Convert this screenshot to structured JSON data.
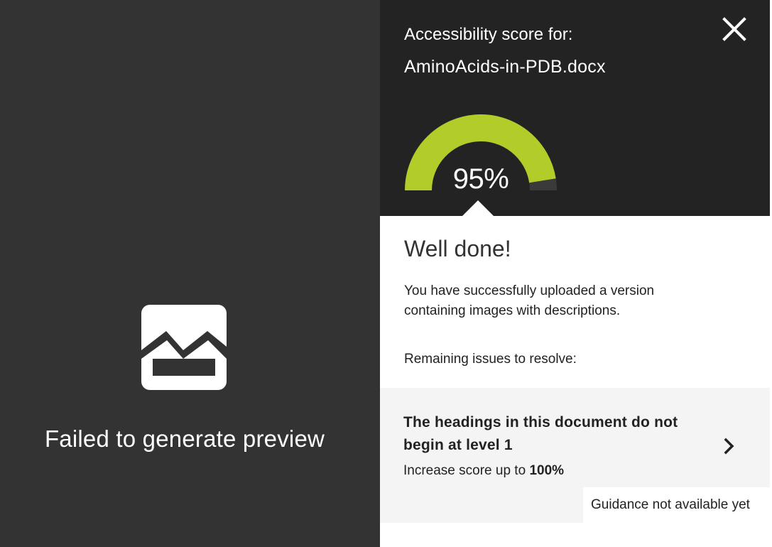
{
  "preview": {
    "icon": "broken-image-icon",
    "message": "Failed to generate preview"
  },
  "score_panel": {
    "label": "Accessibility score for:",
    "file_name": "AminoAcids-in-PDB.docx",
    "close_icon": "close-icon",
    "score_text": "95%",
    "score_fraction": 0.95,
    "colors": {
      "header_background": "#232323",
      "gauge_fill": "#b2cc2a",
      "gauge_track": "#3a3a3a",
      "preview_background": "#333333",
      "issue_background": "#f4f4f4"
    }
  },
  "result": {
    "title": "Well done!",
    "message": "You have successfully uploaded a version containing images with descriptions.",
    "remaining_label": "Remaining issues to resolve:"
  },
  "issue": {
    "title": "The headings in this document do not begin at level 1",
    "score_prefix": "Increase score up to ",
    "score_value": "100%",
    "chevron_icon": "chevron-right-icon",
    "guidance": "Guidance not available yet"
  }
}
